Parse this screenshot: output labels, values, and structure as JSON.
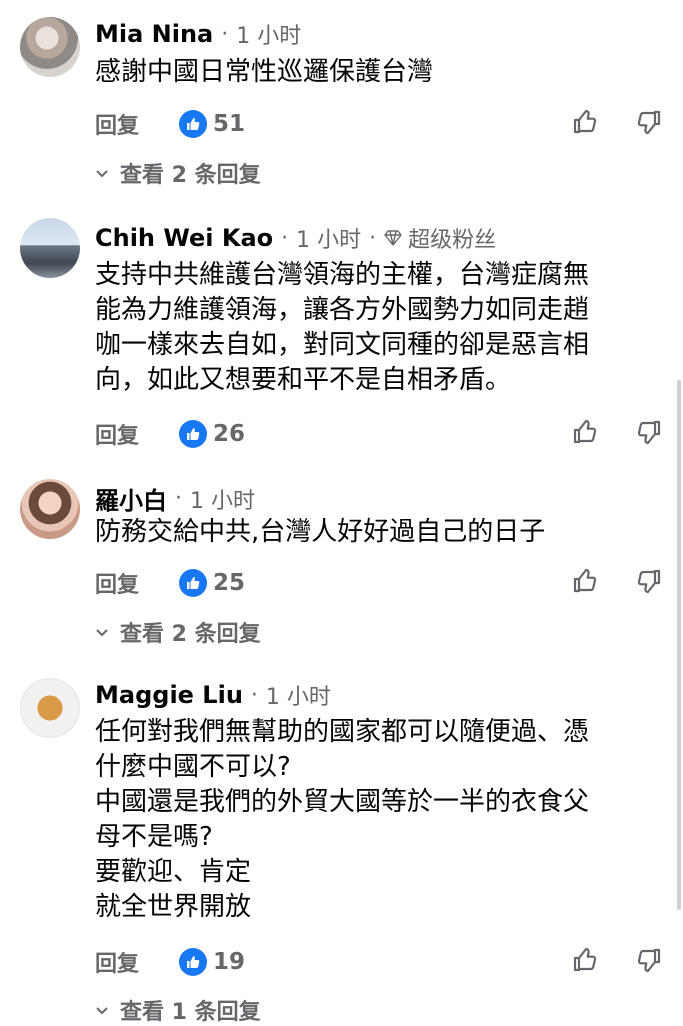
{
  "comments": [
    {
      "author": "Mia Nina",
      "time": "1 小时",
      "badge": "",
      "lines": [
        "感謝中國日常性巡邏保護台灣"
      ],
      "reply_label": "回复",
      "likes": "51",
      "view_replies": "查看 2 条回复"
    },
    {
      "author": "Chih Wei Kao",
      "time": "1 小时",
      "badge": "超级粉丝",
      "lines": [
        "支持中共維護台灣領海的主權，台灣症腐無",
        "能為力維護領海，讓各方外國勢力如同走趙",
        "咖一樣來去自如，對同文同種的卻是惡言相",
        "向，如此又想要和平不是自相矛盾。"
      ],
      "reply_label": "回复",
      "likes": "26",
      "view_replies": ""
    },
    {
      "author": "羅小白",
      "time": "1 小时",
      "badge": "",
      "lines": [
        "防務交給中共,台灣人好好過自己的日子"
      ],
      "reply_label": "回复",
      "likes": "25",
      "view_replies": "查看 2 条回复"
    },
    {
      "author": "Maggie Liu",
      "time": "1 小时",
      "badge": "",
      "lines": [
        "任何對我們無幫助的國家都可以隨便過、憑",
        "什麼中國不可以?",
        "中國還是我們的外貿大國等於一半的衣食父",
        "母不是嗎?",
        "要歡迎、肯定",
        "就全世界開放"
      ],
      "reply_label": "回复",
      "likes": "19",
      "view_replies": "查看 1 条回复"
    }
  ],
  "colors": {
    "like_blue": "#1877f2",
    "meta_gray": "#65676b",
    "text": "#050505"
  },
  "icons": [
    "like-badge-icon",
    "thumbs-up-icon",
    "thumbs-down-icon",
    "chevron-down-icon",
    "diamond-icon"
  ]
}
